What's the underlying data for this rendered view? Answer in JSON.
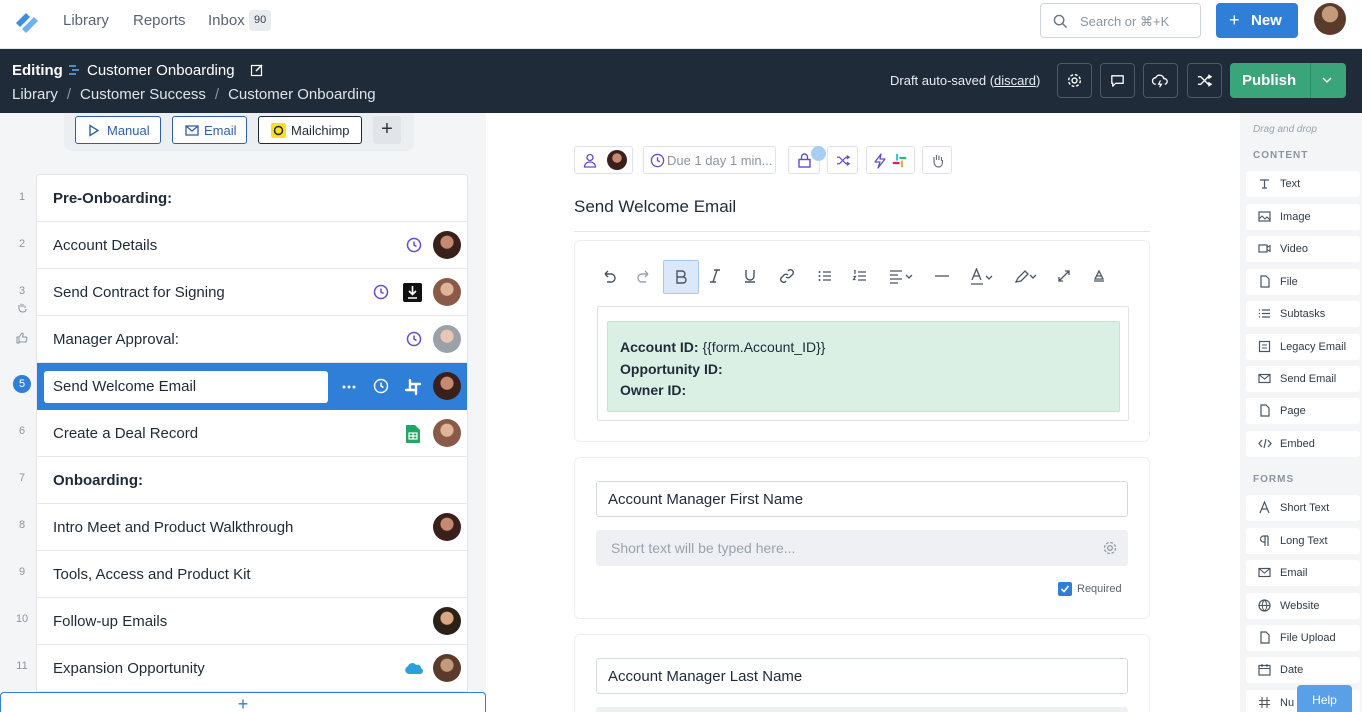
{
  "topnav": {
    "links": [
      "Library",
      "Reports",
      "Inbox"
    ],
    "inbox_count": "90",
    "search_placeholder": "Search or ⌘+K",
    "new_label": "New"
  },
  "editbar": {
    "editing_label": "Editing",
    "workflow_title": "Customer Onboarding",
    "breadcrumbs": [
      "Library",
      "Customer Success",
      "Customer Onboarding"
    ],
    "draft_text": "Draft auto-saved (",
    "discard_label": "discard",
    "draft_close": ")",
    "publish_label": "Publish",
    "publish_color": "#3aa57a"
  },
  "triggers": [
    {
      "label": "Manual",
      "icon": "play-icon",
      "color": "#2f5fa8"
    },
    {
      "label": "Email",
      "icon": "mail-icon",
      "color": "#2f5fa8"
    },
    {
      "label": "Mailchimp",
      "icon": "mailchimp-icon",
      "color": "#1f2a37"
    }
  ],
  "tasks": [
    {
      "num": "1",
      "label": "Pre-Onboarding:",
      "heading": true
    },
    {
      "num": "2",
      "label": "Account Details",
      "clock": true,
      "avatar": true
    },
    {
      "num": "3",
      "label": "Send Contract for Signing",
      "clock": true,
      "download": true,
      "avatar": true
    },
    {
      "num": "",
      "label": "Manager Approval:",
      "clock": true,
      "avatar": true
    },
    {
      "num": "5",
      "label": "Send Welcome Email",
      "selected": true
    },
    {
      "num": "6",
      "label": "Create a Deal Record",
      "sheets": true,
      "avatar": true
    },
    {
      "num": "7",
      "label": "Onboarding:",
      "heading": true
    },
    {
      "num": "8",
      "label": "Intro Meet and Product Walkthrough",
      "avatar": true
    },
    {
      "num": "9",
      "label": "Tools, Access and Product Kit"
    },
    {
      "num": "10",
      "label": "Follow-up Emails",
      "avatar": true
    },
    {
      "num": "11",
      "label": "Expansion Opportunity",
      "salesforce": true,
      "avatar": true
    }
  ],
  "step": {
    "due_label": "Due 1 day 1 min...",
    "title": "Send Welcome Email",
    "content": [
      {
        "key": "Account ID:",
        "value": " {{form.Account_ID}}"
      },
      {
        "key": "Opportunity ID:",
        "value": ""
      },
      {
        "key": "Owner ID:",
        "value": ""
      }
    ],
    "fields": [
      {
        "label": "Account Manager First Name",
        "placeholder": "Short text will be typed here...",
        "required_label": "Required"
      },
      {
        "label": "Account Manager Last Name"
      }
    ]
  },
  "palette": {
    "hint": "Drag and drop",
    "content_heading": "CONTENT",
    "content": [
      "Text",
      "Image",
      "Video",
      "File",
      "Subtasks",
      "Legacy Email",
      "Send Email",
      "Page",
      "Embed"
    ],
    "forms_heading": "FORMS",
    "forms": [
      "Short Text",
      "Long Text",
      "Email",
      "Website",
      "File Upload",
      "Date",
      "Nu"
    ]
  },
  "help_label": "Help",
  "accent_color": "#2f7ed8"
}
